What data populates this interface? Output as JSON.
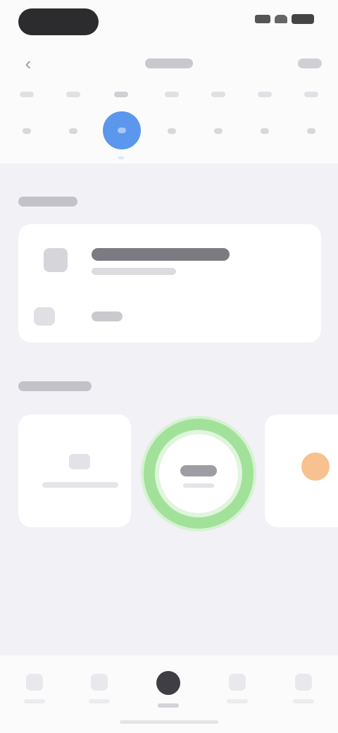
{
  "status_bar": {
    "indicators": [
      "signal-icon",
      "wifi-icon",
      "battery-icon"
    ]
  },
  "nav": {
    "back_icon": "chevron-left-icon",
    "title": "",
    "action": ""
  },
  "week": {
    "days": [
      {
        "dow": "",
        "date": ""
      },
      {
        "dow": "",
        "date": ""
      },
      {
        "dow": "",
        "date": "",
        "selected": true
      },
      {
        "dow": "",
        "date": ""
      },
      {
        "dow": "",
        "date": ""
      },
      {
        "dow": "",
        "date": ""
      },
      {
        "dow": "",
        "date": ""
      }
    ],
    "accent": "#5b97ec"
  },
  "section_1": {
    "label": ""
  },
  "card": {
    "row_1": {
      "icon": "activity-icon",
      "title": "",
      "subtitle": ""
    },
    "row_2": {
      "icon": "bar-icon",
      "value": ""
    }
  },
  "section_2": {
    "label": ""
  },
  "tiles": {
    "tile_1": {
      "icon": "up-arrow-icon",
      "label": ""
    },
    "ring": {
      "value": "",
      "sub": "",
      "color": "#a2e19a"
    },
    "tile_3": {
      "icon": "orange-circle-icon",
      "color": "#f7c28f"
    }
  },
  "tabbar": {
    "tabs": [
      {
        "icon": "tab-1-icon",
        "label": ""
      },
      {
        "icon": "tab-2-icon",
        "label": ""
      },
      {
        "icon": "tab-3-icon",
        "label": "",
        "active": true
      },
      {
        "icon": "tab-4-icon",
        "label": ""
      },
      {
        "icon": "tab-5-icon",
        "label": ""
      }
    ]
  }
}
